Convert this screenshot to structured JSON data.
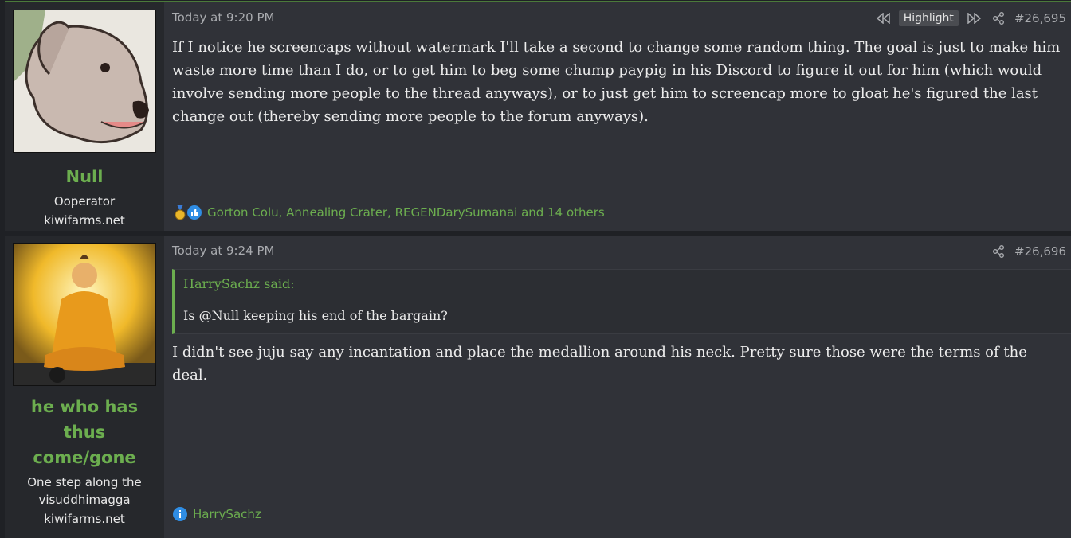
{
  "posts": [
    {
      "user": {
        "name": "Null",
        "title": "Ooperator",
        "site": "kiwifarms.net"
      },
      "timestamp": "Today at 9:20 PM",
      "highlight_label": "Highlight",
      "post_number": "#26,695",
      "text": "If I notice he screencaps without watermark I'll take a second to change some random thing. The goal is just to make him waste more time than I do, or to get him to beg some chump paypig in his Discord to figure it out for him (which would involve sending more people to the thread anyways), or to just get him to screencap more to gloat he's figured the last change out (thereby sending more people to the forum anyways).",
      "reactions": "Gorton Colu, Annealing Crater, REGENDarySumanai and 14 others"
    },
    {
      "user": {
        "name": "he who has thus come/gone",
        "title": "One step along the visuddhimagga",
        "site": "kiwifarms.net"
      },
      "timestamp": "Today at 9:24 PM",
      "post_number": "#26,696",
      "quote": {
        "author": "HarrySachz said:",
        "text": "Is @Null keeping his end of the bargain?"
      },
      "text": "I didn't see juju say any incantation and place the medallion around his neck. Pretty sure those were the terms of the deal.",
      "reactions": "HarrySachz"
    }
  ],
  "colors": {
    "accent_green": "#6cae4f",
    "panel": "#303238",
    "user_panel": "#26282c"
  },
  "icons": [
    "rewind-icon",
    "fast-forward-icon",
    "share-icon",
    "medal-icon",
    "like-icon",
    "info-icon"
  ]
}
